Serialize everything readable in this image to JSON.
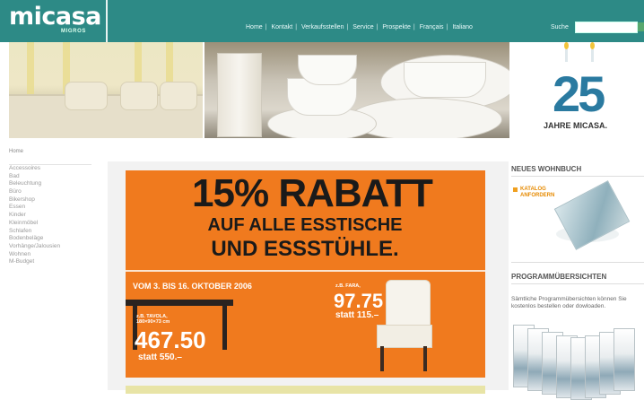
{
  "header": {
    "logo_text": "micasa",
    "logo_sub": "MIGROS",
    "nav": [
      "Home",
      "Kontakt",
      "Verkaufsstellen",
      "Service",
      "Prospekte",
      "Français",
      "Italiano"
    ],
    "nav_separator": "|",
    "search_label": "Suche",
    "search_value": "",
    "colors": {
      "topbar": "#2d8a86",
      "accent_orange": "#f07a1e"
    }
  },
  "banner": {
    "anniversary_number": "25",
    "anniversary_text": "JAHRE MICASA."
  },
  "breadcrumb": "Home",
  "sidebar": {
    "items": [
      "Accessoires",
      "Bad",
      "Beleuchtung",
      "Büro",
      "Bikershop",
      "Essen",
      "Kinder",
      "Kleinmöbel",
      "Schlafen",
      "Bodenbeläge",
      "Vorhänge/Jalousien",
      "Wohnen",
      "M-Budget"
    ]
  },
  "promo": {
    "headline": "15% RABATT",
    "line2": "AUF ALLE ESSTISCHE",
    "line3": "UND ESSSTÜHLE.",
    "date_range": "VOM 3. BIS 16. OKTOBER 2006",
    "product_a": {
      "label_line1": "z.B. TAVOLA,",
      "label_line2": "180×90×73 cm",
      "price": "467.50",
      "old_price": "statt 550.–"
    },
    "product_b": {
      "label": "z.B. FARA,",
      "price": "97.75",
      "old_price": "statt 115.–"
    }
  },
  "right_column": {
    "section1_title": "NEUES WOHNBUCH",
    "katalog_link_line1": "KATALOG",
    "katalog_link_line2": "ANFORDERN",
    "section2_title": "PROGRAMMÜBERSICHTEN",
    "section2_text": "Sämtliche Programmübersichten können Sie kostenlos bestellen oder dowloaden."
  }
}
